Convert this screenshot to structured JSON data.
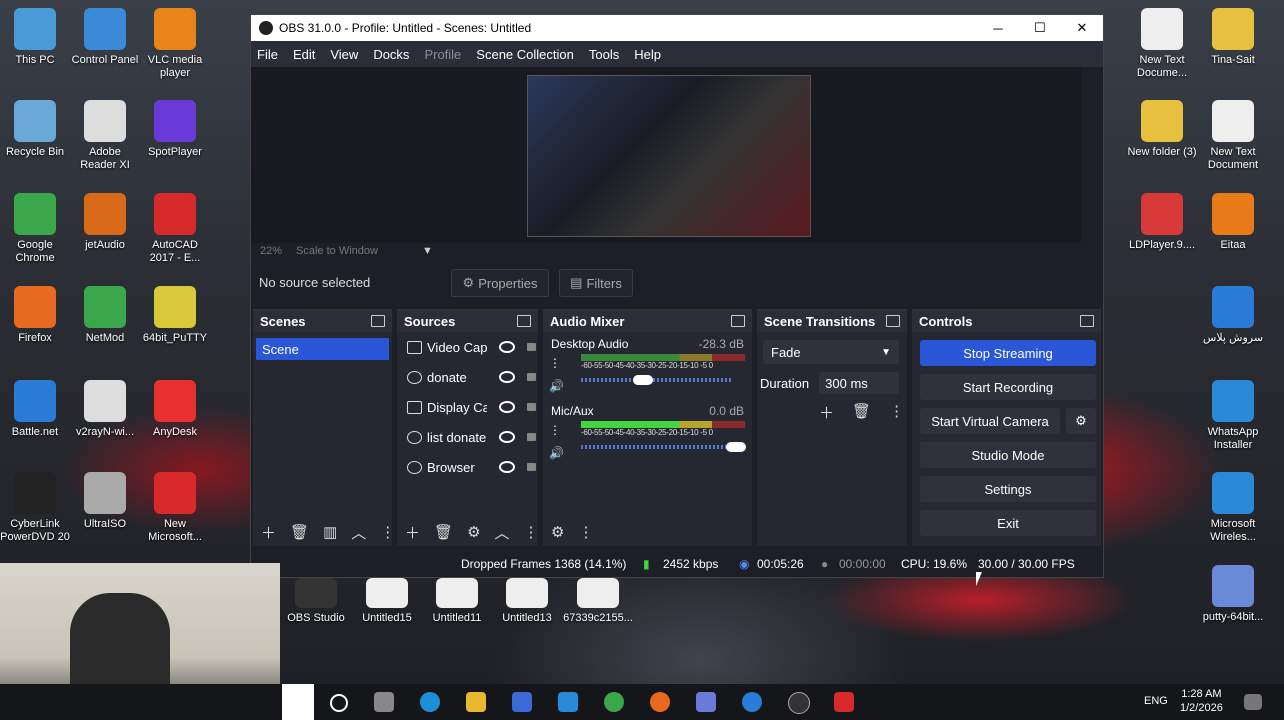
{
  "window": {
    "title": "OBS 31.0.0 - Profile: Untitled - Scenes: Untitled",
    "minimize": "─",
    "maximize": "☐",
    "close": "✕"
  },
  "menu": {
    "items": [
      "File",
      "Edit",
      "View",
      "Docks",
      "Profile",
      "Scene Collection",
      "Tools",
      "Help"
    ]
  },
  "preview": {
    "zoom": "22%",
    "scale_mode": "Scale to Window"
  },
  "source_bar": {
    "no_source": "No source selected",
    "properties": "Properties",
    "filters": "Filters"
  },
  "scenes": {
    "title": "Scenes",
    "items": [
      "Scene"
    ]
  },
  "sources": {
    "title": "Sources",
    "items": [
      "Video Capt",
      "donate",
      "Display Ca",
      "list donate",
      "Browser"
    ]
  },
  "audio_mixer": {
    "title": "Audio Mixer",
    "channels": [
      {
        "name": "Desktop Audio",
        "db": "-28.3 dB"
      },
      {
        "name": "Mic/Aux",
        "db": "0.0 dB"
      }
    ],
    "ticks": "-60-55-50-45-40-35-30-25-20-15-10 -5  0"
  },
  "scene_transitions": {
    "title": "Scene Transitions",
    "transition": "Fade",
    "duration_label": "Duration",
    "duration_value": "300 ms"
  },
  "controls": {
    "title": "Controls",
    "stop_streaming": "Stop Streaming",
    "start_recording": "Start Recording",
    "start_virtual_camera": "Start Virtual Camera",
    "studio_mode": "Studio Mode",
    "settings": "Settings",
    "exit": "Exit"
  },
  "status": {
    "dropped_frames": "Dropped Frames 1368 (14.1%)",
    "bitrate": "2452 kbps",
    "stream_time": "00:05:26",
    "record_time": "00:00:00",
    "cpu": "CPU: 19.6%",
    "fps": "30.00 / 30.00 FPS"
  },
  "desktop_icons_left": [
    {
      "label": "This PC"
    },
    {
      "label": "Control Panel"
    },
    {
      "label": "VLC media player"
    },
    {
      "label": "Recycle Bin"
    },
    {
      "label": "Adobe Reader XI"
    },
    {
      "label": "SpotPlayer"
    },
    {
      "label": "Google Chrome"
    },
    {
      "label": "jetAudio"
    },
    {
      "label": "AutoCAD 2017 - E..."
    },
    {
      "label": "Firefox"
    },
    {
      "label": "NetMod"
    },
    {
      "label": "64bit_PuTTY"
    },
    {
      "label": "Battle.net"
    },
    {
      "label": "v2rayN-wi..."
    },
    {
      "label": "AnyDesk"
    },
    {
      "label": "CyberLink PowerDVD 20"
    },
    {
      "label": "UltraISO"
    },
    {
      "label": "New Microsoft..."
    }
  ],
  "desktop_icons_right": [
    {
      "label": "New Text Docume..."
    },
    {
      "label": "Tina-Sait"
    },
    {
      "label": "New folder (3)"
    },
    {
      "label": "New Text Document"
    },
    {
      "label": "LDPlayer.9...."
    },
    {
      "label": "Eitaa"
    },
    {
      "label": "سروش پلاس"
    },
    {
      "label": "WhatsApp Installer"
    },
    {
      "label": "Microsoft Wireles..."
    },
    {
      "label": "putty-64bit..."
    }
  ],
  "desktop_row_bottom": [
    {
      "label": "OBS Studio"
    },
    {
      "label": "Untitled15"
    },
    {
      "label": "Untitled11"
    },
    {
      "label": "Untitled13"
    },
    {
      "label": "67339c2155..."
    }
  ],
  "taskbar": {
    "lang": "ENG",
    "time": "1:28 AM",
    "date": "1/2/2026"
  }
}
